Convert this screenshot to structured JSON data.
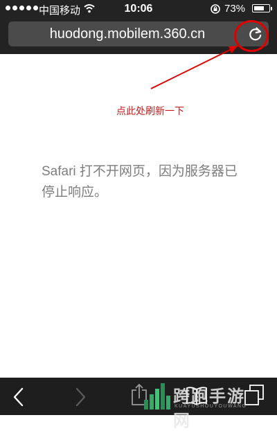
{
  "status_bar": {
    "carrier": "中国移动",
    "time": "10:06",
    "battery_percent": "73%",
    "battery_level": 0.73
  },
  "browser": {
    "url": "huodong.mobilem.360.cn"
  },
  "page": {
    "annotation": "点此处刷新一下",
    "error_message": "Safari 打不开网页，因为服务器已停止响应。"
  },
  "watermark": {
    "brand": "跨跑手游网",
    "sub": "KUAYUSHOUYOUWANG"
  },
  "colors": {
    "annotation_red": "#e00000",
    "annotation_text": "#c41a1a",
    "chrome_dark": "#232323"
  }
}
